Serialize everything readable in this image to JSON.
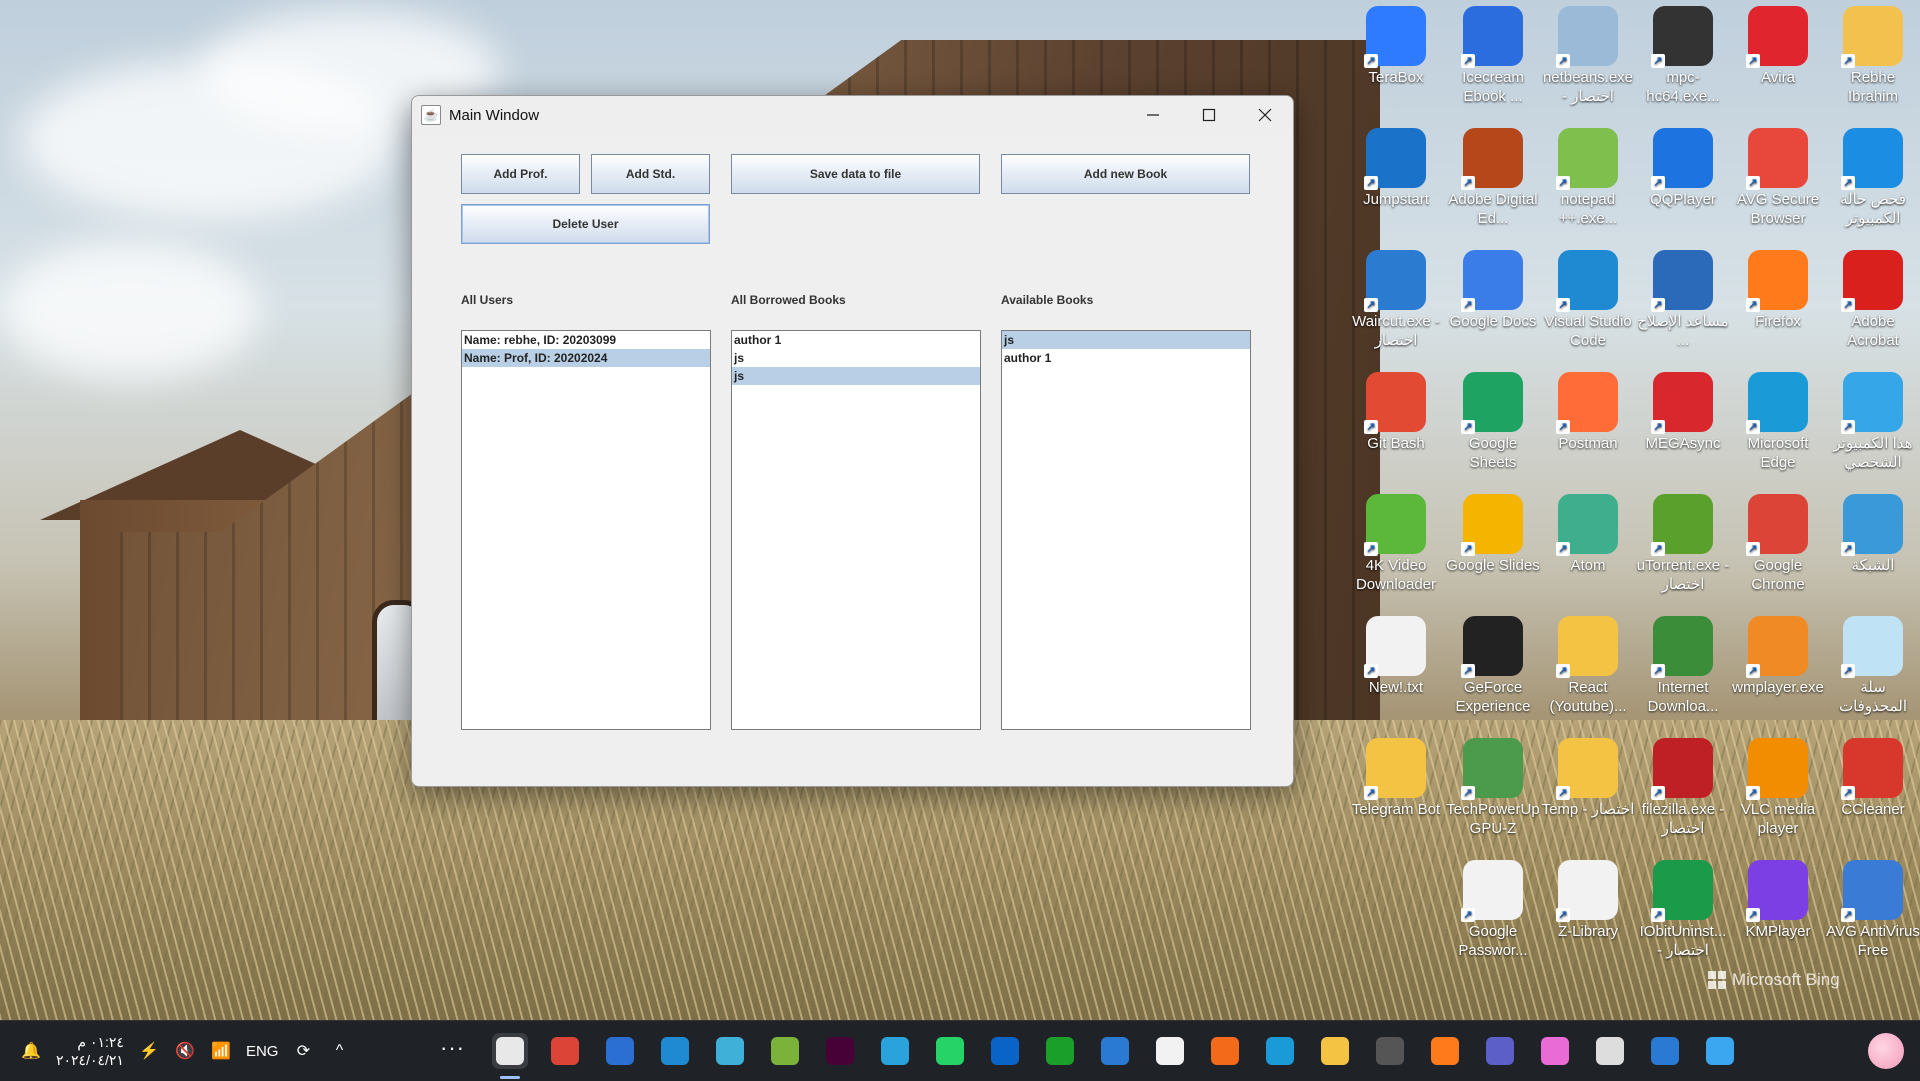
{
  "window": {
    "title": "Main Window",
    "buttons": {
      "add_prof": "Add Prof.",
      "add_std": "Add Std.",
      "save_data": "Save data to file",
      "add_book": "Add new Book",
      "delete_user": "Delete User"
    },
    "labels": {
      "all_users": "All Users",
      "borrowed_books": "All Borrowed Books",
      "available_books": "Available Books"
    },
    "lists": {
      "users": [
        {
          "text": "Name: rebhe, ID: 20203099",
          "selected": false
        },
        {
          "text": "Name: Prof, ID: 20202024",
          "selected": true
        }
      ],
      "borrowed": [
        {
          "text": "author 1",
          "selected": false
        },
        {
          "text": "js",
          "selected": false
        },
        {
          "text": "js",
          "selected": true
        }
      ],
      "available": [
        {
          "text": "js",
          "selected": true
        },
        {
          "text": "author 1",
          "selected": false
        }
      ]
    }
  },
  "desktop": {
    "icons": [
      {
        "label": "TeraBox",
        "icon": "terabox-icon",
        "color": "#2f7bff"
      },
      {
        "label": "Icecream Ebook ...",
        "icon": "ebook-icon",
        "color": "#2b6cde"
      },
      {
        "label": "netbeans.exe - اختصار",
        "icon": "netbeans-icon",
        "color": "#9bbad8"
      },
      {
        "label": "mpc-hc64.exe...",
        "icon": "mpc-icon",
        "color": "#333333"
      },
      {
        "label": "Avira",
        "icon": "avira-icon",
        "color": "#e0252f"
      },
      {
        "label": "Rebhe Ibrahim",
        "icon": "user-folder-icon",
        "color": "#f2c14e"
      },
      {
        "label": "Jumpstart",
        "icon": "jumpstart-icon",
        "color": "#1a73c8"
      },
      {
        "label": "Adobe Digital Ed...",
        "icon": "adobe-de-icon",
        "color": "#b5471b"
      },
      {
        "label": "notepad ++.exe...",
        "icon": "notepadpp-icon",
        "color": "#7fbf4d"
      },
      {
        "label": "QQPlayer",
        "icon": "qqplayer-icon",
        "color": "#1d74e0"
      },
      {
        "label": "AVG Secure Browser",
        "icon": "avg-browser-icon",
        "color": "#e8473b"
      },
      {
        "label": "فحص حالة الكمبيوتر",
        "icon": "pc-health-icon",
        "color": "#1b8ee3"
      },
      {
        "label": "Waircut.exe - اختصار",
        "icon": "waircut-icon",
        "color": "#2b7bd0"
      },
      {
        "label": "Google Docs",
        "icon": "google-docs-icon",
        "color": "#3b7de8"
      },
      {
        "label": "Visual Studio Code",
        "icon": "vscode-icon",
        "color": "#1f8ad2"
      },
      {
        "label": "مساعد الإصلاح ...",
        "icon": "repair-icon",
        "color": "#2a6ab8"
      },
      {
        "label": "Firefox",
        "icon": "firefox-icon",
        "color": "#ff7a1a"
      },
      {
        "label": "Adobe Acrobat",
        "icon": "acrobat-icon",
        "color": "#d9201c"
      },
      {
        "label": "Git Bash",
        "icon": "git-bash-icon",
        "color": "#e34a33"
      },
      {
        "label": "Google Sheets",
        "icon": "google-sheets-icon",
        "color": "#1ea362"
      },
      {
        "label": "Postman",
        "icon": "postman-icon",
        "color": "#ff6c37"
      },
      {
        "label": "MEGAsync",
        "icon": "mega-icon",
        "color": "#d9272e"
      },
      {
        "label": "Microsoft Edge",
        "icon": "edge-icon",
        "color": "#1a9bd7"
      },
      {
        "label": "هذا الكمبيوتر الشخصي",
        "icon": "this-pc-icon",
        "color": "#35a7e8"
      },
      {
        "label": "4K Video Downloader",
        "icon": "4k-downloader-icon",
        "color": "#5bb83a"
      },
      {
        "label": "Google Slides",
        "icon": "google-slides-icon",
        "color": "#f4b400"
      },
      {
        "label": "Atom",
        "icon": "atom-icon",
        "color": "#3fae8c"
      },
      {
        "label": "uTorrent.exe - اختصار",
        "icon": "utorrent-icon",
        "color": "#5aa02c"
      },
      {
        "label": "Google Chrome",
        "icon": "chrome-icon",
        "color": "#db4437"
      },
      {
        "label": "الشبكة",
        "icon": "network-icon",
        "color": "#3a9ad9"
      },
      {
        "label": "New!.txt",
        "icon": "text-file-icon",
        "color": "#f2f2f2"
      },
      {
        "label": "GeForce Experience",
        "icon": "geforce-icon",
        "color": "#222222"
      },
      {
        "label": "React (Youtube)...",
        "icon": "folder-icon",
        "color": "#f5c343"
      },
      {
        "label": "Internet Downloa...",
        "icon": "idm-icon",
        "color": "#3b8d3a"
      },
      {
        "label": "wmplayer.exe",
        "icon": "wmplayer-icon",
        "color": "#f08a24"
      },
      {
        "label": "سلة المحذوفات",
        "icon": "recycle-bin-icon",
        "color": "#bfe3f5"
      },
      {
        "label": "Telegram Bot",
        "icon": "folder-icon",
        "color": "#f5c343"
      },
      {
        "label": "TechPowerUp GPU-Z",
        "icon": "gpuz-icon",
        "color": "#4c9b4c"
      },
      {
        "label": "Temp - اختصار",
        "icon": "folder-icon",
        "color": "#f5c343"
      },
      {
        "label": "filezilla.exe - اختصار",
        "icon": "filezilla-icon",
        "color": "#bf2026"
      },
      {
        "label": "VLC media player",
        "icon": "vlc-icon",
        "color": "#f28c00"
      },
      {
        "label": "CCleaner",
        "icon": "ccleaner-icon",
        "color": "#d8382b"
      },
      {
        "label": "Google Passwor...",
        "icon": "google-password-icon",
        "color": "#f2f2f2"
      },
      {
        "label": "Z-Library",
        "icon": "zlibrary-icon",
        "color": "#f2f2f2"
      },
      {
        "label": "IObitUninst... - اختصار",
        "icon": "iobit-icon",
        "color": "#1b9a4a"
      },
      {
        "label": "KMPlayer",
        "icon": "kmplayer-icon",
        "color": "#7b3fe4"
      },
      {
        "label": "AVG AntiVirus Free",
        "icon": "avg-antivirus-icon",
        "color": "#3a7bd5"
      }
    ],
    "bing": "Microsoft Bing"
  },
  "taskbar": {
    "time": "٠١:٢٤ م",
    "date": "٢٠٢٤/٠٤/٢١",
    "language": "ENG",
    "apps": [
      {
        "icon": "java-icon",
        "color": "#e8e8e8",
        "active": true
      },
      {
        "icon": "chrome-icon",
        "color": "#db4437"
      },
      {
        "icon": "media-icon",
        "color": "#2a6fd1"
      },
      {
        "icon": "vscode-icon",
        "color": "#1f8ad2"
      },
      {
        "icon": "gradient-app-icon",
        "color": "#3fb0d8"
      },
      {
        "icon": "mql-icon",
        "color": "#7bb33a"
      },
      {
        "icon": "adobe-xd-icon",
        "color": "#470137"
      },
      {
        "icon": "telegram-icon",
        "color": "#2aa3dc"
      },
      {
        "icon": "whatsapp-icon",
        "color": "#25d366"
      },
      {
        "icon": "intel-icon",
        "color": "#0a64c8"
      },
      {
        "icon": "xbox-icon",
        "color": "#1a9f2a"
      },
      {
        "icon": "mail-icon",
        "color": "#2a7ad4"
      },
      {
        "icon": "store-icon",
        "color": "#f2f2f2"
      },
      {
        "icon": "xampp-icon",
        "color": "#f46a1b"
      },
      {
        "icon": "edge-icon",
        "color": "#1a9bd7"
      },
      {
        "icon": "file-explorer-icon",
        "color": "#f5c343"
      },
      {
        "icon": "calculator-icon",
        "color": "#555555"
      },
      {
        "icon": "firefox-icon",
        "color": "#ff7a1a"
      },
      {
        "icon": "teams-icon",
        "color": "#5b5fc7"
      },
      {
        "icon": "copilot-icon",
        "color": "#e86bd6"
      },
      {
        "icon": "task-view-icon",
        "color": "#dddddd"
      },
      {
        "icon": "search-icon",
        "color": "#2a7ad4"
      },
      {
        "icon": "start-icon",
        "color": "#3aa7f0"
      }
    ]
  }
}
